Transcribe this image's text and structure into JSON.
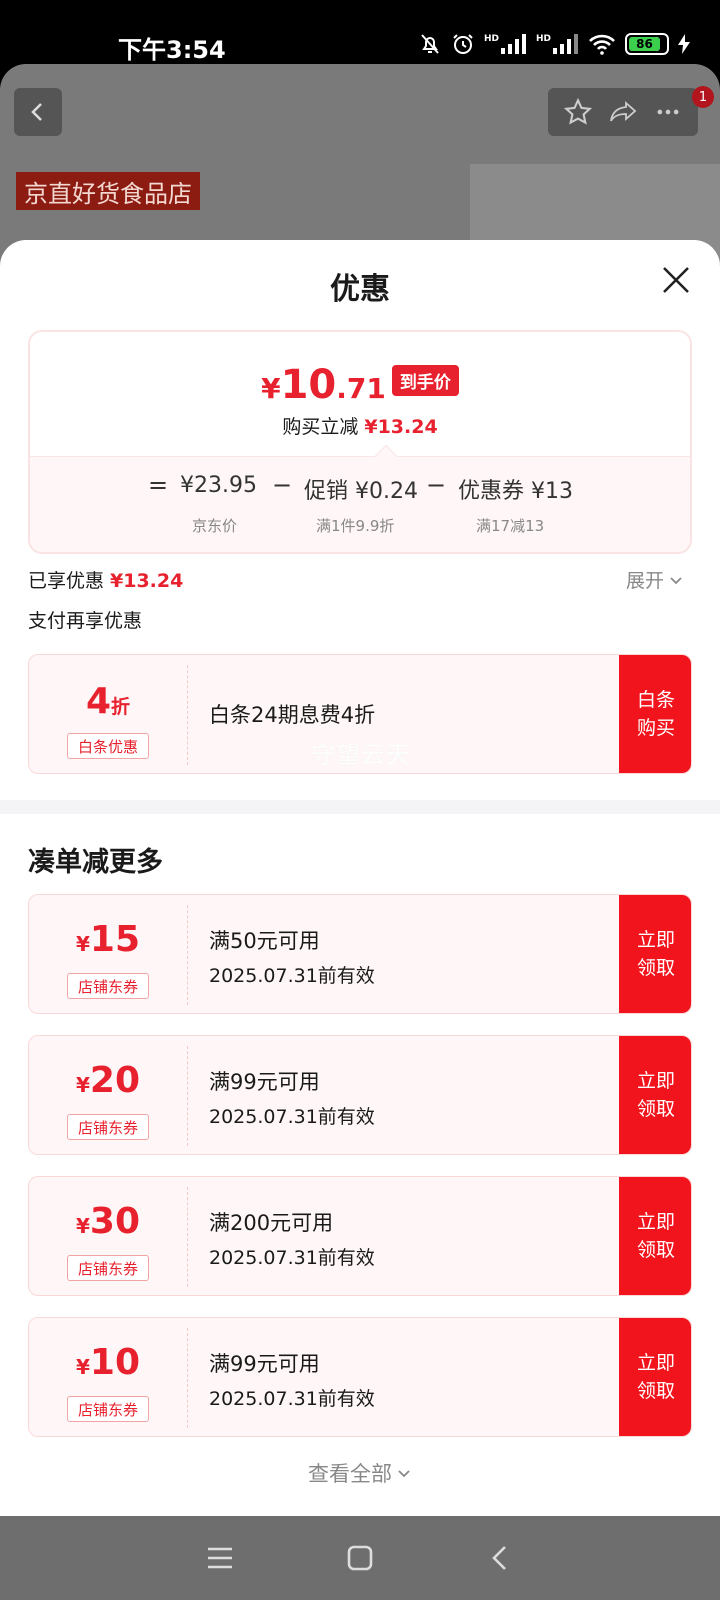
{
  "status_bar": {
    "time": "下午3:54",
    "battery": "86",
    "hd1": "HD",
    "hd2": "HD"
  },
  "background": {
    "shop_name": "京直好货食品店",
    "badge_count": "1"
  },
  "sheet": {
    "title": "优惠",
    "price": {
      "yen": "¥",
      "int": "10",
      "dec": ".71",
      "tag": "到手价",
      "instant_label": "购买立减",
      "instant_value": "¥13.24"
    },
    "calc": {
      "eq": "=",
      "jd_price": "¥23.95",
      "jd_label": "京东价",
      "minus1": "−",
      "promo": "促销 ¥0.24",
      "promo_label": "满1件9.9折",
      "minus2": "−",
      "coupon": "优惠券 ¥13",
      "coupon_label": "满17减13"
    },
    "enjoyed_label": "已享优惠",
    "enjoyed_value": "¥13.24",
    "expand_label": "展开",
    "pay_more_label": "支付再享优惠",
    "baitiao": {
      "num": "4",
      "unit": "折",
      "tag": "白条优惠",
      "desc": "白条24期息费4折",
      "button_line1": "白条",
      "button_line2": "购买",
      "watermark": "守望云天"
    },
    "more_title": "凑单减更多",
    "coupons": [
      {
        "yen": "¥",
        "amount": "15",
        "tag": "店铺东券",
        "cond": "满50元可用",
        "valid": "2025.07.31前有效",
        "btn1": "立即",
        "btn2": "领取"
      },
      {
        "yen": "¥",
        "amount": "20",
        "tag": "店铺东券",
        "cond": "满99元可用",
        "valid": "2025.07.31前有效",
        "btn1": "立即",
        "btn2": "领取"
      },
      {
        "yen": "¥",
        "amount": "30",
        "tag": "店铺东券",
        "cond": "满200元可用",
        "valid": "2025.07.31前有效",
        "btn1": "立即",
        "btn2": "领取"
      },
      {
        "yen": "¥",
        "amount": "10",
        "tag": "店铺东券",
        "cond": "满99元可用",
        "valid": "2025.07.31前有效",
        "btn1": "立即",
        "btn2": "领取"
      }
    ],
    "view_all": "查看全部"
  },
  "icons": {
    "back": "chevron-left-icon",
    "star": "star-icon",
    "share": "share-icon",
    "more": "more-icon",
    "close": "close-icon",
    "expand": "chevron-down-icon"
  },
  "colors": {
    "accent": "#e8212e",
    "button": "#f2141d"
  }
}
